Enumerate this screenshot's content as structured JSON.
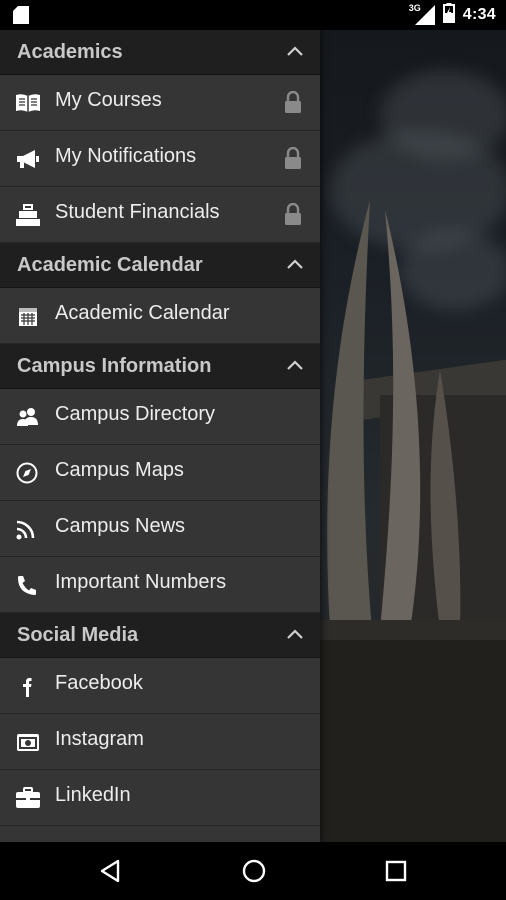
{
  "status_bar": {
    "time": "4:34",
    "network_tag": "3G",
    "icons": [
      "sd-card-icon",
      "signal-icon",
      "battery-icon"
    ]
  },
  "colors": {
    "drawer_bg": "#353535",
    "header_bg": "#1f1f1f",
    "text": "#ededed",
    "header_text": "#c8c8c8",
    "icon": "#ffffff",
    "lock": "#8a8a8a"
  },
  "drawer": {
    "sections": [
      {
        "title": "Academics",
        "items": [
          {
            "label": "My Courses",
            "icon": "book-icon",
            "locked": true
          },
          {
            "label": "My Notifications",
            "icon": "megaphone-icon",
            "locked": true
          },
          {
            "label": "Student Financials",
            "icon": "cash-register-icon",
            "locked": true
          }
        ]
      },
      {
        "title": "Academic Calendar",
        "items": [
          {
            "label": "Academic Calendar",
            "icon": "calendar-icon",
            "locked": false
          }
        ]
      },
      {
        "title": "Campus Information",
        "items": [
          {
            "label": "Campus Directory",
            "icon": "people-icon",
            "locked": false
          },
          {
            "label": "Campus Maps",
            "icon": "compass-icon",
            "locked": false
          },
          {
            "label": "Campus News",
            "icon": "rss-icon",
            "locked": false
          },
          {
            "label": "Important Numbers",
            "icon": "phone-icon",
            "locked": false
          }
        ]
      },
      {
        "title": "Social Media",
        "items": [
          {
            "label": "Facebook",
            "icon": "facebook-icon",
            "locked": false
          },
          {
            "label": "Instagram",
            "icon": "instagram-icon",
            "locked": false
          },
          {
            "label": "LinkedIn",
            "icon": "linkedin-icon",
            "locked": false
          }
        ]
      }
    ]
  },
  "nav_bar": {
    "buttons": [
      "back-icon",
      "home-icon",
      "recents-icon"
    ]
  }
}
